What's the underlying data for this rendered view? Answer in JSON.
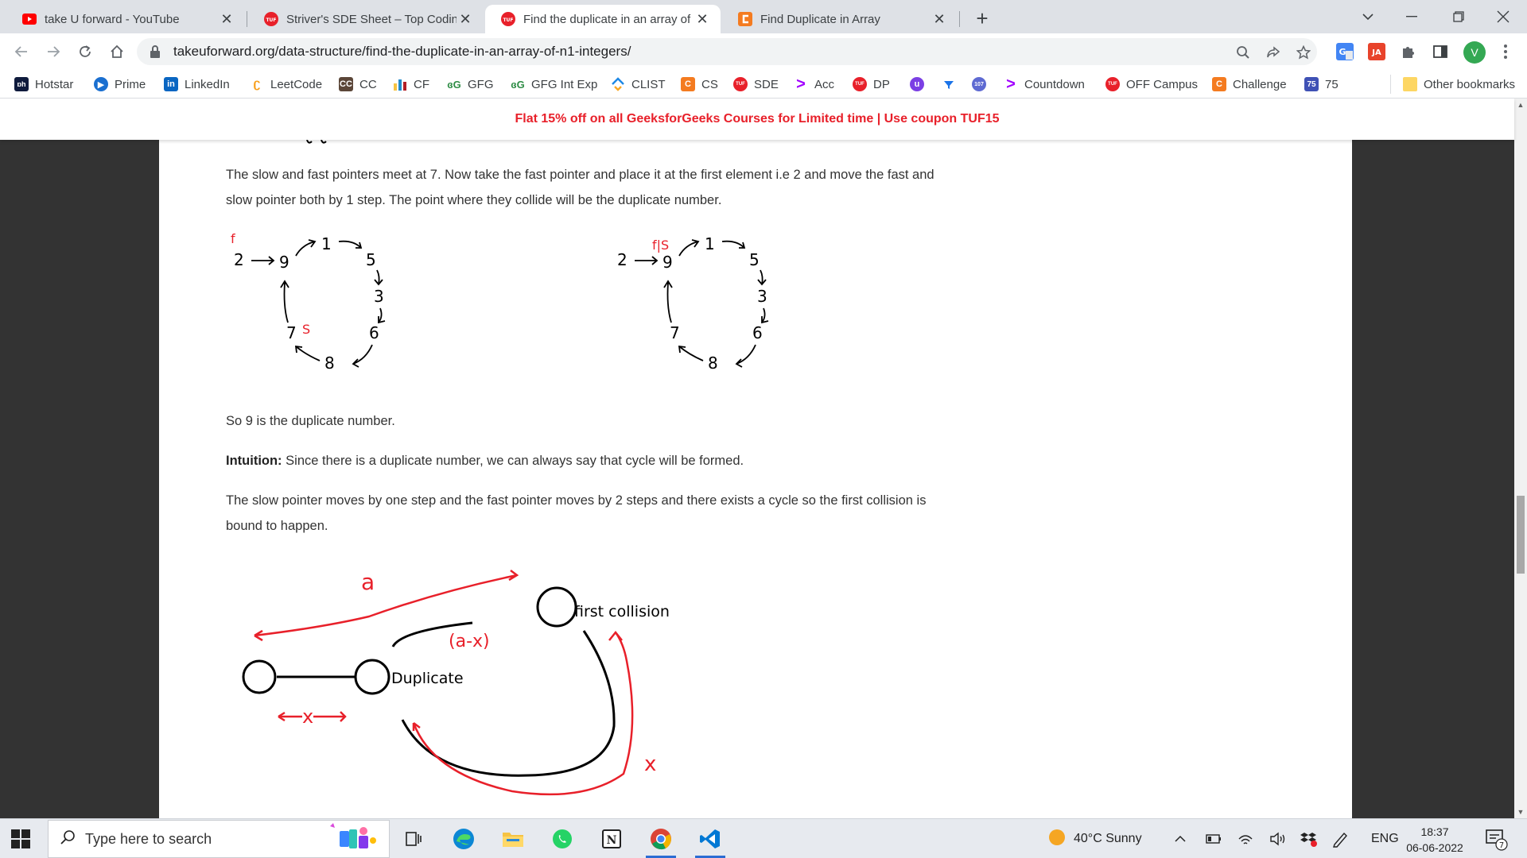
{
  "browser": {
    "tabs": [
      {
        "title": "take U forward - YouTube",
        "favicon": "youtube-icon",
        "active": false
      },
      {
        "title": "Striver's SDE Sheet – Top Coding",
        "favicon": "tuf-icon",
        "active": false
      },
      {
        "title": "Find the duplicate in an array of N",
        "favicon": "tuf-icon",
        "active": true
      },
      {
        "title": "Find Duplicate in Array",
        "favicon": "codestudio-icon",
        "active": false
      }
    ],
    "new_tab": "+",
    "url": "takeuforward.org/data-structure/find-the-duplicate-in-an-array-of-n1-integers/",
    "profile_initial": "V",
    "bookmarks": [
      {
        "label": "Hotstar",
        "icon": "hotstar-icon"
      },
      {
        "label": "Prime",
        "icon": "prime-icon"
      },
      {
        "label": "LinkedIn",
        "icon": "linkedin-icon"
      },
      {
        "label": "LeetCode",
        "icon": "leetcode-icon"
      },
      {
        "label": "CC",
        "icon": "codechef-icon"
      },
      {
        "label": "CF",
        "icon": "codeforces-icon"
      },
      {
        "label": "GFG",
        "icon": "gfg-icon"
      },
      {
        "label": "GFG Int Exp",
        "icon": "gfg-icon"
      },
      {
        "label": "CLIST",
        "icon": "clist-icon"
      },
      {
        "label": "CS",
        "icon": "codestudio-icon"
      },
      {
        "label": "SDE",
        "icon": "tuf-icon"
      },
      {
        "label": "Acc",
        "icon": "accenture-icon"
      },
      {
        "label": "DP",
        "icon": "tuf-icon"
      },
      {
        "label": "",
        "icon": "circle-u-icon"
      },
      {
        "label": "",
        "icon": "funnel-icon"
      },
      {
        "label": "",
        "icon": "calendar-107-icon"
      },
      {
        "label": "Countdown",
        "icon": "accenture-icon"
      },
      {
        "label": "OFF Campus",
        "icon": "tuf-icon"
      },
      {
        "label": "Challenge",
        "icon": "codestudio-icon"
      },
      {
        "label": "75",
        "icon": "badge-75-icon"
      },
      {
        "label": "Other bookmarks",
        "icon": "folder-icon"
      }
    ],
    "calendar_badge": "107",
    "badge_75": "75"
  },
  "page": {
    "promo": "Flat 15% off on all GeeksforGeeks Courses for Limited time | Use coupon TUF15",
    "para1_line1": "The slow and fast pointers meet at 7. Now take the fast pointer and place it at the first element i.e 2 and move the fast and",
    "para1_line2": "slow pointer both by 1 step. The point where they collide will be the duplicate number.",
    "conclusion": "So 9 is the duplicate number.",
    "intuition_label": "Intuition:",
    "intuition_text": " Since there is a duplicate number, we can always say that cycle will be formed.",
    "para3_line1": "The slow pointer moves by one step and the fast pointer moves by 2 steps and there exists a cycle so the first collision is",
    "para3_line2": "bound to happen.",
    "cycle_left": {
      "nodes": [
        "2",
        "9",
        "1",
        "5",
        "3",
        "6",
        "8",
        "7"
      ],
      "mark_f": "f",
      "mark_s": "S"
    },
    "cycle_right": {
      "nodes": [
        "2",
        "9",
        "1",
        "5",
        "3",
        "6",
        "8",
        "7"
      ],
      "mark_fs": "f|S"
    },
    "collision_diagram": {
      "label_first_collision": "first collision",
      "label_duplicate": "Duplicate",
      "label_a": "a",
      "label_a_minus_x": "(a-x)",
      "label_x_bottom": "x",
      "label_x_right": "x"
    }
  },
  "taskbar": {
    "search_placeholder": "Type here to search",
    "weather": "40°C  Sunny",
    "language": "ENG",
    "time": "18:37",
    "date": "06-06-2022",
    "notification_count": "7"
  }
}
